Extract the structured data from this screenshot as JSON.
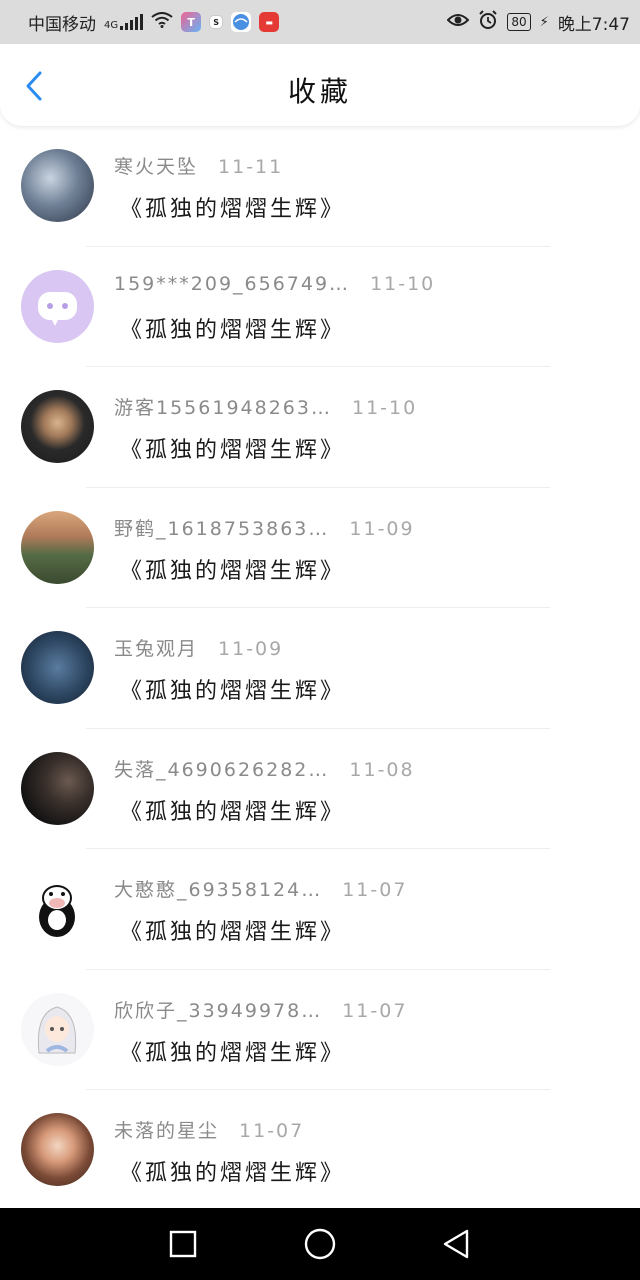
{
  "status_bar": {
    "carrier": "中国移动",
    "network": "4G",
    "battery": "80",
    "time": "晚上7:47"
  },
  "header": {
    "title": "收藏",
    "back_icon": "chevron-left-icon"
  },
  "favorites": [
    {
      "user": "寒火天坠",
      "date": "11-11",
      "title": "《孤独的熠熠生辉》"
    },
    {
      "user": "159***209_656749…",
      "date": "11-10",
      "title": "《孤独的熠熠生辉》"
    },
    {
      "user": "游客15561948263…",
      "date": "11-10",
      "title": "《孤独的熠熠生辉》"
    },
    {
      "user": "野鹤_1618753863…",
      "date": "11-09",
      "title": "《孤独的熠熠生辉》"
    },
    {
      "user": "玉兔观月",
      "date": "11-09",
      "title": "《孤独的熠熠生辉》"
    },
    {
      "user": "失落_4690626282…",
      "date": "11-08",
      "title": "《孤独的熠熠生辉》"
    },
    {
      "user": "大憨憨_69358124…",
      "date": "11-07",
      "title": "《孤独的熠熠生辉》"
    },
    {
      "user": "欣欣子_33949978…",
      "date": "11-07",
      "title": "《孤独的熠熠生辉》"
    },
    {
      "user": "未落的星尘",
      "date": "11-07",
      "title": "《孤独的熠熠生辉》"
    }
  ],
  "colors": {
    "accent": "#2a8cf0",
    "status_bar_bg": "#dcdcdc",
    "nav_bar_bg": "#000000"
  },
  "nav_bar": {
    "icons": [
      "recent-apps-icon",
      "home-icon",
      "back-triangle-icon"
    ]
  }
}
